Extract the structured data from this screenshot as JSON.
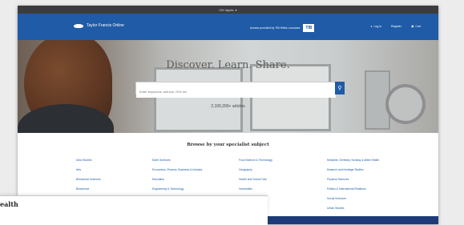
{
  "topbar": {
    "label": "OH Inputs",
    "chevron": "▾"
  },
  "navbar": {
    "brand": "Taylor Francis Online",
    "access_text": "Access provided by TIB Hilfes Lounsses",
    "institution_logo": "TIB",
    "links": [
      {
        "icon": "person-icon",
        "label": "Log in"
      },
      {
        "icon": "none",
        "label": "Register"
      },
      {
        "icon": "cart-icon",
        "label": "Cart"
      }
    ]
  },
  "hero": {
    "title": "Discover. Learn. Share.",
    "search_placeholder": "Enter keywords, authors, DOI etc",
    "search_icon": "search-icon",
    "count": "2,100,200+ articles"
  },
  "subjects": {
    "heading": "Browse by your specialist subject",
    "columns": [
      [
        "Area Studies",
        "Arts",
        "Behavioral Sciences",
        "Bioscience",
        "Built Environment",
        "Computer Science"
      ],
      [
        "Earth Sciences",
        "Economics, Finance, Business & Industry",
        "Education",
        "Engineering & Technology",
        "Environment & Agriculture",
        "Environment and Sustainability"
      ],
      [
        "Food Science & Technology",
        "Geography",
        "Health and Social Care",
        "Humanities",
        "Language & Literature",
        "Law"
      ],
      [
        "Medicine, Dentistry, Nursing & Allied Health",
        "Museum and Heritage Studies",
        "Physical Sciences",
        "Politics & International Relations",
        "Social Sciences",
        "Urban Studies"
      ]
    ]
  },
  "overlay": {
    "label": "ealth"
  }
}
